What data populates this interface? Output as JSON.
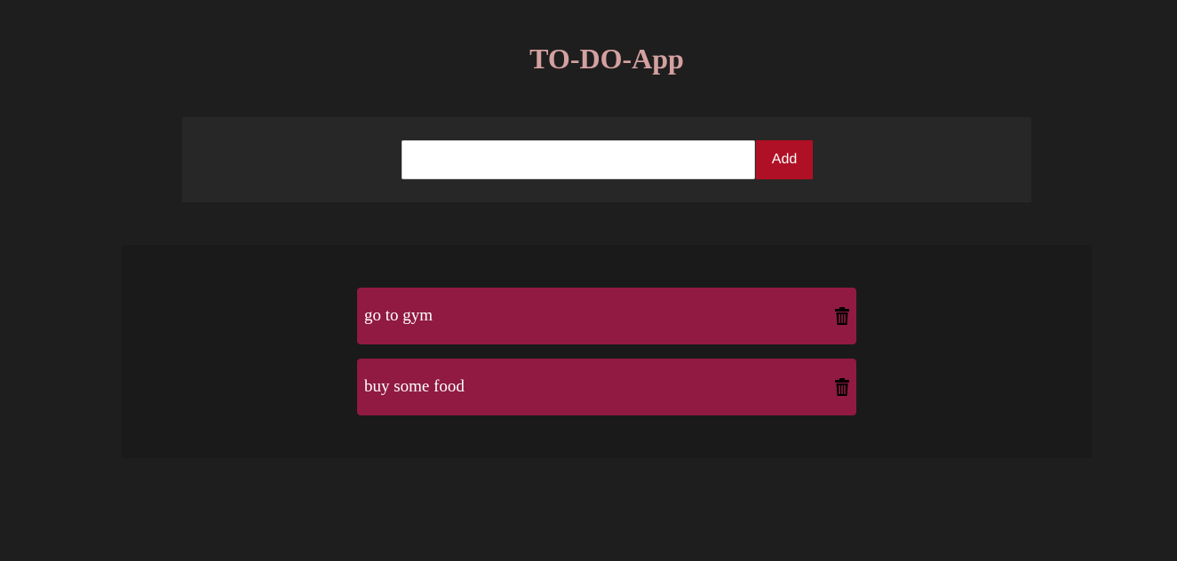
{
  "app": {
    "title": "TO-DO-App"
  },
  "input": {
    "value": "",
    "placeholder": "",
    "add_label": "Add"
  },
  "todos": [
    {
      "text": "go to gym",
      "icon": "trash-icon"
    },
    {
      "text": "buy some food",
      "icon": "trash-icon"
    }
  ],
  "colors": {
    "background": "#1e1e1e",
    "title": "#d4a0a0",
    "input_panel": "#272727",
    "list_panel": "#1a1a1a",
    "add_button": "#b01025",
    "todo_item": "#901a42",
    "trash_icon": "#000000"
  }
}
